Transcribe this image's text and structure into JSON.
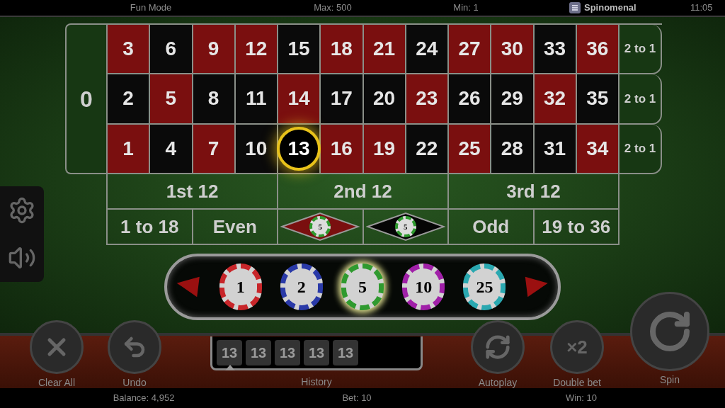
{
  "top_bar": {
    "mode": "Fun Mode",
    "max": "Max: 500",
    "min": "Min: 1",
    "brand": "Spinomenal",
    "time": "11:05"
  },
  "table": {
    "zero": "0",
    "numbers": [
      {
        "label": "3",
        "color": "#7a0f0f",
        "selected": false
      },
      {
        "label": "6",
        "color": "#0a0a0a",
        "selected": false
      },
      {
        "label": "9",
        "color": "#7a0f0f",
        "selected": false
      },
      {
        "label": "12",
        "color": "#7a0f0f",
        "selected": false
      },
      {
        "label": "15",
        "color": "#0a0a0a",
        "selected": false
      },
      {
        "label": "18",
        "color": "#7a0f0f",
        "selected": false
      },
      {
        "label": "21",
        "color": "#7a0f0f",
        "selected": false
      },
      {
        "label": "24",
        "color": "#0a0a0a",
        "selected": false
      },
      {
        "label": "27",
        "color": "#7a0f0f",
        "selected": false
      },
      {
        "label": "30",
        "color": "#7a0f0f",
        "selected": false
      },
      {
        "label": "33",
        "color": "#0a0a0a",
        "selected": false
      },
      {
        "label": "36",
        "color": "#7a0f0f",
        "selected": false
      },
      {
        "label": "2",
        "color": "#0a0a0a",
        "selected": false
      },
      {
        "label": "5",
        "color": "#7a0f0f",
        "selected": false
      },
      {
        "label": "8",
        "color": "#0a0a0a",
        "selected": false
      },
      {
        "label": "11",
        "color": "#0a0a0a",
        "selected": false
      },
      {
        "label": "14",
        "color": "#7a0f0f",
        "selected": false
      },
      {
        "label": "17",
        "color": "#0a0a0a",
        "selected": false
      },
      {
        "label": "20",
        "color": "#0a0a0a",
        "selected": false
      },
      {
        "label": "23",
        "color": "#7a0f0f",
        "selected": false
      },
      {
        "label": "26",
        "color": "#0a0a0a",
        "selected": false
      },
      {
        "label": "29",
        "color": "#0a0a0a",
        "selected": false
      },
      {
        "label": "32",
        "color": "#7a0f0f",
        "selected": false
      },
      {
        "label": "35",
        "color": "#0a0a0a",
        "selected": false
      },
      {
        "label": "1",
        "color": "#7a0f0f",
        "selected": false
      },
      {
        "label": "4",
        "color": "#0a0a0a",
        "selected": false
      },
      {
        "label": "7",
        "color": "#7a0f0f",
        "selected": false
      },
      {
        "label": "10",
        "color": "#0a0a0a",
        "selected": false
      },
      {
        "label": "13",
        "color": "#0a0a0a",
        "selected": true
      },
      {
        "label": "16",
        "color": "#7a0f0f",
        "selected": false
      },
      {
        "label": "19",
        "color": "#7a0f0f",
        "selected": false
      },
      {
        "label": "22",
        "color": "#0a0a0a",
        "selected": false
      },
      {
        "label": "25",
        "color": "#7a0f0f",
        "selected": false
      },
      {
        "label": "28",
        "color": "#0a0a0a",
        "selected": false
      },
      {
        "label": "31",
        "color": "#0a0a0a",
        "selected": false
      },
      {
        "label": "34",
        "color": "#7a0f0f",
        "selected": false
      }
    ],
    "column_bets": [
      "2 to 1",
      "2 to 1",
      "2 to 1"
    ],
    "dozens": [
      "1st 12",
      "2nd 12",
      "3rd 12"
    ],
    "outside": [
      {
        "kind": "text",
        "label": "1 to 18"
      },
      {
        "kind": "text",
        "label": "Even"
      },
      {
        "kind": "diamond",
        "color": "#7a0f0f",
        "chip": "5"
      },
      {
        "kind": "diamond",
        "color": "#050505",
        "chip": "5"
      },
      {
        "kind": "text",
        "label": "Odd"
      },
      {
        "kind": "text",
        "label": "19 to 36"
      }
    ]
  },
  "chips": [
    {
      "value": "1",
      "color": "#c8262a",
      "selected": false
    },
    {
      "value": "2",
      "color": "#2a3aa8",
      "selected": false
    },
    {
      "value": "5",
      "color": "#2f9a2f",
      "selected": true
    },
    {
      "value": "10",
      "color": "#a020a8",
      "selected": false
    },
    {
      "value": "25",
      "color": "#2aa8b0",
      "selected": false
    }
  ],
  "controls_left": [
    {
      "kind": "clear",
      "label": "Clear All"
    },
    {
      "kind": "undo",
      "label": "Undo"
    }
  ],
  "history": {
    "label": "History",
    "numbers": [
      "13",
      "13",
      "13",
      "13",
      "13"
    ]
  },
  "controls_right": [
    {
      "kind": "autoplay",
      "label": "Autoplay"
    },
    {
      "kind": "double",
      "label": "Double bet",
      "icon_text": "×2"
    },
    {
      "kind": "spin",
      "label": "Spin"
    }
  ],
  "status_bar": {
    "balance": "Balance: 4,952",
    "bet": "Bet: 10",
    "win": "Win: 10"
  }
}
